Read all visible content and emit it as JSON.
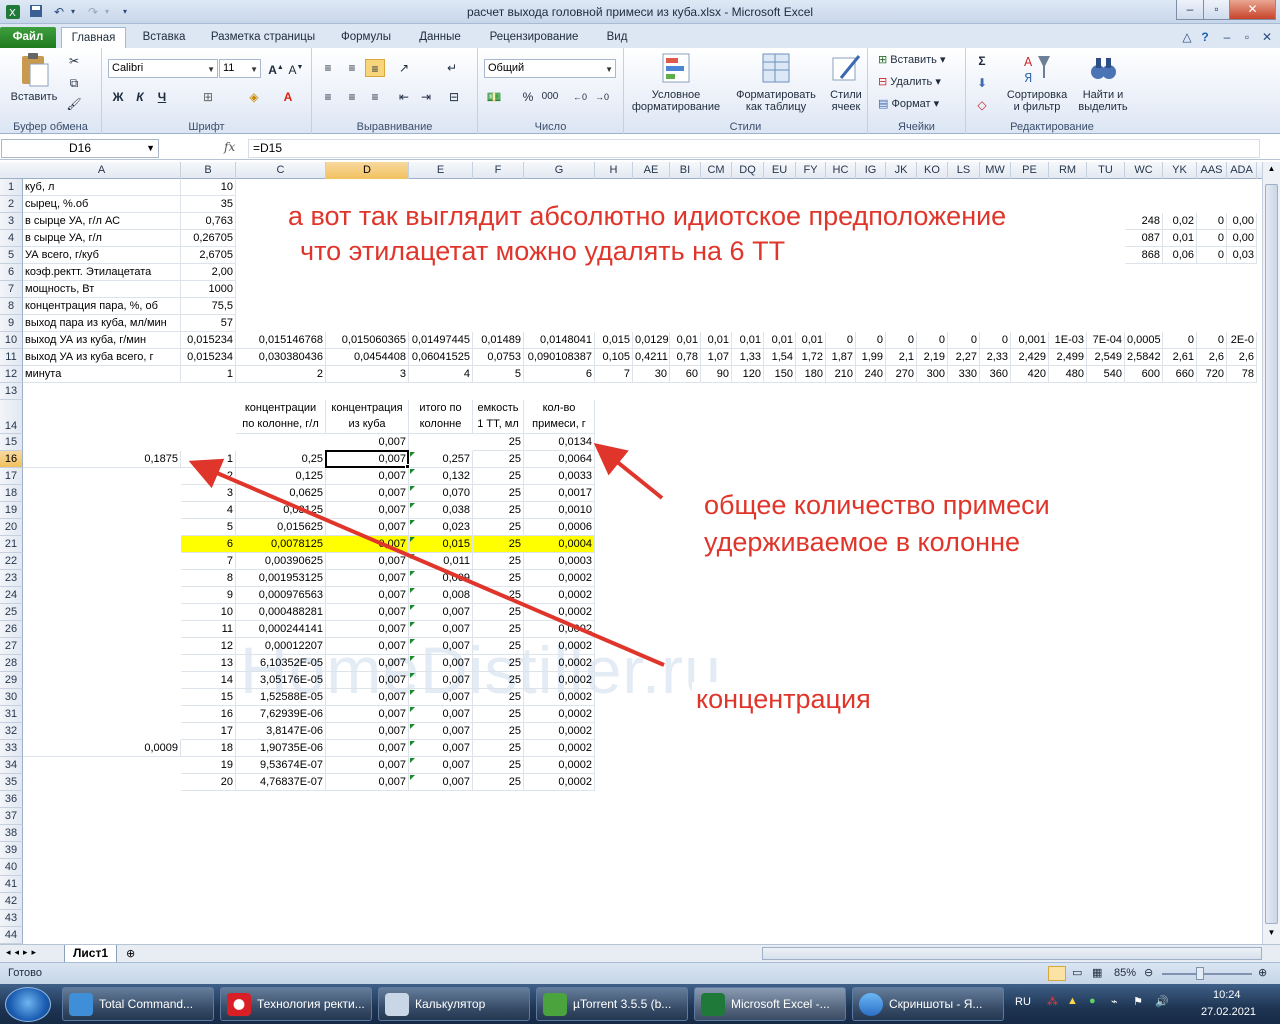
{
  "window": {
    "title": "расчет выхода головной примеси из куба.xlsx - Microsoft Excel"
  },
  "ribbon": {
    "tabs": [
      "Файл",
      "Главная",
      "Вставка",
      "Разметка страницы",
      "Формулы",
      "Данные",
      "Рецензирование",
      "Вид"
    ],
    "groups": {
      "clipboard": {
        "label": "Буфер обмена",
        "paste": "Вставить"
      },
      "font": {
        "label": "Шрифт",
        "font_name": "Calibri",
        "font_size": "11",
        "bold": "Ж",
        "italic": "К",
        "underline": "Ч"
      },
      "alignment": {
        "label": "Выравнивание"
      },
      "number": {
        "label": "Число",
        "format": "Общий",
        "percent": "%",
        "thousands": "000"
      },
      "styles": {
        "label": "Стили",
        "cond_format": [
          "Условное",
          "форматирование"
        ],
        "format_table": [
          "Форматировать",
          "как таблицу"
        ],
        "cell_styles": [
          "Стили",
          "ячеек"
        ]
      },
      "cells": {
        "label": "Ячейки",
        "insert": "Вставить",
        "delete": "Удалить",
        "format": "Формат"
      },
      "editing": {
        "label": "Редактирование",
        "sort": [
          "Сортировка",
          "и фильтр"
        ],
        "find": [
          "Найти и",
          "выделить"
        ]
      }
    }
  },
  "formula_bar": {
    "name_box": "D16",
    "fx": "fx",
    "formula": "=D15"
  },
  "columns": [
    "A",
    "B",
    "C",
    "D",
    "E",
    "F",
    "G",
    "H",
    "AE",
    "BI",
    "CM",
    "DQ",
    "EU",
    "FY",
    "HC",
    "IG",
    "JK",
    "KO",
    "LS",
    "MW",
    "PE",
    "RM",
    "TU",
    "WC",
    "YK",
    "AAS",
    "ADA"
  ],
  "rows": [
    "1",
    "2",
    "3",
    "4",
    "5",
    "6",
    "7",
    "8",
    "9",
    "10",
    "11",
    "12",
    "13",
    "14",
    "15",
    "16",
    "17",
    "18",
    "19",
    "20",
    "21",
    "22",
    "23",
    "24",
    "25",
    "26",
    "27",
    "28",
    "29",
    "30",
    "31",
    "32",
    "33",
    "34",
    "35",
    "36",
    "37",
    "38",
    "39",
    "40",
    "41",
    "42",
    "43",
    "44"
  ],
  "sheet": {
    "labels": {
      "r1": "куб, л",
      "r2": "сырец, %.об",
      "r3": "в сырце УА, г/л АС",
      "r4": "в сырце УА, г/л",
      "r5": "УА всего, г/куб",
      "r6": "коэф.ректт. Этилацетата",
      "r7": "мощность, Вт",
      "r8": "концентрация пара, %, об",
      "r9": "выход пара из куба, мл/мин",
      "r10": "выход УА из куба, г/мин",
      "r11": "выход УА из куба всего, г",
      "r12": "минута"
    },
    "b_values": {
      "r1": "10",
      "r2": "35",
      "r3": "0,763",
      "r4": "0,26705",
      "r5": "2,6705",
      "r6": "2,00",
      "r7": "1000",
      "r8": "75,5",
      "r9": "57",
      "r10": "0,015234",
      "r11": "0,015234",
      "r12": "1"
    },
    "row3_tail": [
      "248",
      "0,02",
      "0",
      "0,00"
    ],
    "row4_tail": [
      "087",
      "0,01",
      "0",
      "0,00"
    ],
    "row5_tail": [
      "868",
      "0,06",
      "0",
      "0,03"
    ],
    "row10": [
      "0,015234",
      "0,015146768",
      "0,015060365",
      "0,01497445",
      "0,01489",
      "0,0148041",
      "0,015",
      "0,0129",
      "0,01",
      "0,01",
      "0,01",
      "0,01",
      "0,01",
      "0",
      "0",
      "0",
      "0",
      "0",
      "0",
      "0,001",
      "1E-03",
      "7E-04",
      "0,0005",
      "0",
      "0",
      "2E-0"
    ],
    "row11": [
      "0,015234",
      "0,030380436",
      "0,0454408",
      "0,06041525",
      "0,0753",
      "0,090108387",
      "0,105",
      "0,4211",
      "0,78",
      "1,07",
      "1,33",
      "1,54",
      "1,72",
      "1,87",
      "1,99",
      "2,1",
      "2,19",
      "2,27",
      "2,33",
      "2,429",
      "2,499",
      "2,549",
      "2,5842",
      "2,61",
      "2,6",
      "2,6"
    ],
    "row12": [
      "1",
      "2",
      "3",
      "4",
      "5",
      "6",
      "7",
      "30",
      "60",
      "90",
      "120",
      "150",
      "180",
      "210",
      "240",
      "270",
      "300",
      "330",
      "360",
      "420",
      "480",
      "540",
      "600",
      "660",
      "720",
      "78"
    ],
    "table_headers": {
      "c": [
        "концентрации",
        "по колонне, г/л"
      ],
      "d": [
        "концентрация",
        "из куба"
      ],
      "e": [
        "итого по",
        "колонне"
      ],
      "f": [
        "емкость",
        "1 ТТ, мл"
      ],
      "g": [
        "кол-во",
        "примеси, г"
      ]
    },
    "row15": {
      "d": "0,007",
      "f": "25",
      "g": "0,0134"
    },
    "a16": "0,1875",
    "a33": "0,0009",
    "table_rows": [
      {
        "b": "1",
        "c": "0,25",
        "d": "0,007",
        "e": "0,257",
        "f": "25",
        "g": "0,0064"
      },
      {
        "b": "2",
        "c": "0,125",
        "d": "0,007",
        "e": "0,132",
        "f": "25",
        "g": "0,0033"
      },
      {
        "b": "3",
        "c": "0,0625",
        "d": "0,007",
        "e": "0,070",
        "f": "25",
        "g": "0,0017"
      },
      {
        "b": "4",
        "c": "0,03125",
        "d": "0,007",
        "e": "0,038",
        "f": "25",
        "g": "0,0010"
      },
      {
        "b": "5",
        "c": "0,015625",
        "d": "0,007",
        "e": "0,023",
        "f": "25",
        "g": "0,0006"
      },
      {
        "b": "6",
        "c": "0,0078125",
        "d": "0,007",
        "e": "0,015",
        "f": "25",
        "g": "0,0004"
      },
      {
        "b": "7",
        "c": "0,00390625",
        "d": "0,007",
        "e": "0,011",
        "f": "25",
        "g": "0,0003"
      },
      {
        "b": "8",
        "c": "0,001953125",
        "d": "0,007",
        "e": "0,009",
        "f": "25",
        "g": "0,0002"
      },
      {
        "b": "9",
        "c": "0,000976563",
        "d": "0,007",
        "e": "0,008",
        "f": "25",
        "g": "0,0002"
      },
      {
        "b": "10",
        "c": "0,000488281",
        "d": "0,007",
        "e": "0,007",
        "f": "25",
        "g": "0,0002"
      },
      {
        "b": "11",
        "c": "0,000244141",
        "d": "0,007",
        "e": "0,007",
        "f": "25",
        "g": "0,0002"
      },
      {
        "b": "12",
        "c": "0,00012207",
        "d": "0,007",
        "e": "0,007",
        "f": "25",
        "g": "0,0002"
      },
      {
        "b": "13",
        "c": "6,10352E-05",
        "d": "0,007",
        "e": "0,007",
        "f": "25",
        "g": "0,0002"
      },
      {
        "b": "14",
        "c": "3,05176E-05",
        "d": "0,007",
        "e": "0,007",
        "f": "25",
        "g": "0,0002"
      },
      {
        "b": "15",
        "c": "1,52588E-05",
        "d": "0,007",
        "e": "0,007",
        "f": "25",
        "g": "0,0002"
      },
      {
        "b": "16",
        "c": "7,62939E-06",
        "d": "0,007",
        "e": "0,007",
        "f": "25",
        "g": "0,0002"
      },
      {
        "b": "17",
        "c": "3,8147E-06",
        "d": "0,007",
        "e": "0,007",
        "f": "25",
        "g": "0,0002"
      },
      {
        "b": "18",
        "c": "1,90735E-06",
        "d": "0,007",
        "e": "0,007",
        "f": "25",
        "g": "0,0002"
      },
      {
        "b": "19",
        "c": "9,53674E-07",
        "d": "0,007",
        "e": "0,007",
        "f": "25",
        "g": "0,0002"
      },
      {
        "b": "20",
        "c": "4,76837E-07",
        "d": "0,007",
        "e": "0,007",
        "f": "25",
        "g": "0,0002"
      }
    ]
  },
  "annotations": {
    "top_line1": "а вот так выглядит абсолютно идиотское предположение",
    "top_line2": "что этилацетат можно удалять на 6 ТТ",
    "right_line1": "общее количество примеси",
    "right_line2": "удерживаемое в колонне",
    "bottom": "концентрация",
    "color": "#e0352b"
  },
  "sheet_tabs": {
    "active": "Лист1"
  },
  "status": {
    "ready": "Готово",
    "zoom": "85%"
  },
  "taskbar": {
    "buttons": [
      "Total Command...",
      "Технология ректи...",
      "Калькулятор",
      "µTorrent 3.5.5  (b...",
      "Microsoft Excel -...",
      "Скриншоты - Я..."
    ],
    "lang": "RU",
    "time": "10:24",
    "date": "27.02.2021"
  },
  "watermark": "HomeDistiller.ru"
}
